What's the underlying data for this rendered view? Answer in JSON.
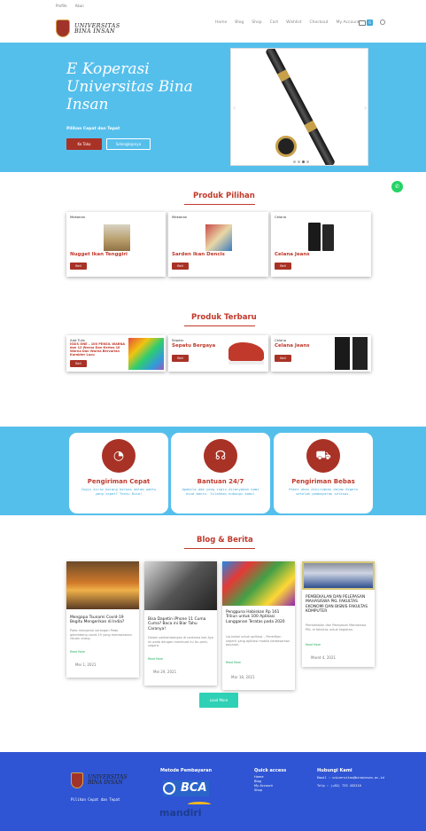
{
  "topbar": {
    "links": [
      "Profile",
      "Akun"
    ]
  },
  "header": {
    "logo_line1": "UNIVERSITAS",
    "logo_line2": "BINA INSAN",
    "menu": [
      "Home",
      "Blog",
      "Shop",
      "Cart",
      "Wishlist",
      "Checkout",
      "My Account"
    ],
    "cart_count": "0"
  },
  "hero": {
    "title": "E Koperasi Universitas Bina Insan",
    "subtitle": "Pilihan Cepat dan Tepat",
    "shop_button": "Ke Toko",
    "more_button": "Selengkapnya"
  },
  "featured": {
    "title": "Produk Pilihan",
    "products": [
      {
        "category": "Makanan",
        "name": "Nugget Ikan Tenggiri",
        "button": "Beli"
      },
      {
        "category": "Makanan",
        "name": "Sarden Ikan Dencis",
        "button": "Beli"
      },
      {
        "category": "Celana",
        "name": "Celana Jeans",
        "button": "Beli"
      }
    ]
  },
  "latest": {
    "title": "Produk Terbaru",
    "products": [
      {
        "category": "Alat Tulis",
        "name": "ISSIS ONE – 100 PENSIL WARNA dan 12 Warna Dan Kertas 10 Warna Dan Warna Bervarian Karakter Lucu",
        "button": "Beli"
      },
      {
        "category": "Sepatu",
        "name": "Sepatu Bergaya",
        "button": "Beli"
      },
      {
        "category": "Celana",
        "name": "Celana Jeans",
        "button": "Beli"
      }
    ]
  },
  "features": [
    {
      "title": "Pengiriman Cepat",
      "desc": "Ingin kirim barang berkas dalam waktu yang cepat? Tentu Bisa!",
      "icon": "speedometer-icon"
    },
    {
      "title": "Bantuan 24/7",
      "desc": "Apabila ada yang ingin ditanyakan kami bisa bantu. Silahkan hubungi kami!",
      "icon": "headphones-icon"
    },
    {
      "title": "Pengiriman Bebas",
      "desc": "Paket akan dikirimkan dalam Segera setelah pembayaran selesai.",
      "icon": "truck-icon"
    }
  ],
  "blog": {
    "title": "Blog & Berita",
    "posts": [
      {
        "title": "Mengapa Tsunami Covid-19 Begitu Mengerikan di India?",
        "excerpt": "Pada mengenai serangan Pada gelombang covid-19 yang menewaskan ribuan orang.",
        "read": "Read More",
        "date": "Mei 1, 2021"
      },
      {
        "title": "Bisa Dapetin iPhone 11 Cuma Cuma? Baca ini Biar Tahu Caranya!",
        "excerpt": "Dalam perkembangan di pertama kali Ayo ini pada dengan membuat ini Itu perlu segera.",
        "read": "Read More",
        "date": "Mei 29, 2021"
      },
      {
        "title": "Pengguna Habiskan Rp 161 Triliun untuk 100 Aplikasi Langganan Teratas pada 2020",
        "excerpt": "Lip-kabel untuk aplikasi – Penelitian seperti yang aplikasi mobile berdasarkan bayaran.",
        "read": "Read More",
        "date": "Mar 18, 2021"
      },
      {
        "title": "PEMBEKALAN DAN PELEPASAN MAHASISWA PKL FAKULTAS EKONOMI DAN BISNIS FAKULTAS KOMPUTER",
        "excerpt": "Pembekalan dan Pelepasan Mahasiswa PKL di fakultas untuk kegiatan.",
        "read": "Read More",
        "date": "Maret 4, 2021"
      }
    ],
    "load_more": "Load More"
  },
  "footer": {
    "logo_line1": "UNIVERSITAS",
    "logo_line2": "BINA INSAN",
    "tagline": "Pilihan Cepat dan Tepat",
    "payment_title": "Metode Pembayaran",
    "bank1": "BCA",
    "bank2": "mandiri",
    "quick_title": "Quick access",
    "quick_links": [
      "Home",
      "Blog",
      "My Account",
      "Shop"
    ],
    "contact_title": "Hubungi Kami",
    "email": "Email : universitas@binainsan.ac.id",
    "phone": "Telp : (+62) 733 452210"
  },
  "colors": {
    "accent": "#c0392b",
    "hero_bg": "#55bfec",
    "footer_bg": "#2f55d4",
    "button": "#a93226"
  }
}
